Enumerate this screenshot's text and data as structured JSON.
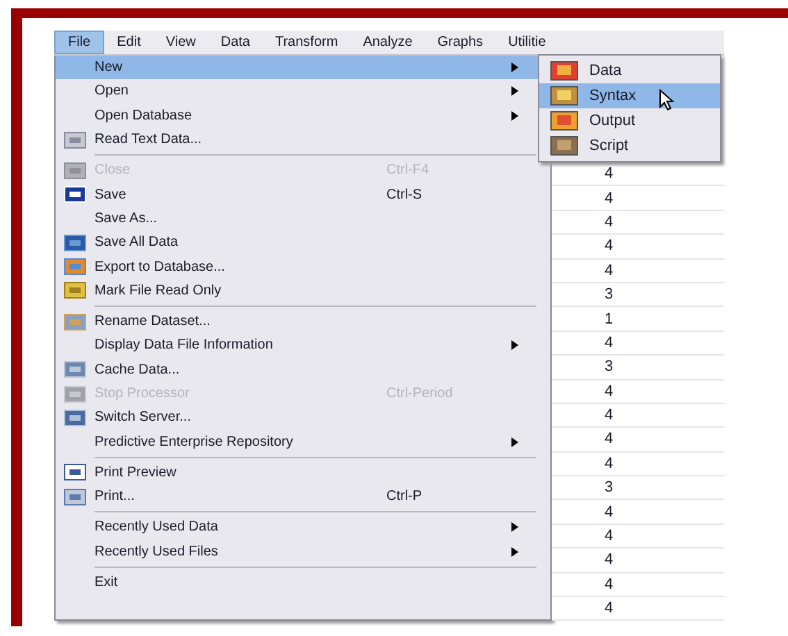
{
  "menubar": [
    {
      "label": "File",
      "selected": true
    },
    {
      "label": "Edit",
      "selected": false
    },
    {
      "label": "View",
      "selected": false
    },
    {
      "label": "Data",
      "selected": false
    },
    {
      "label": "Transform",
      "selected": false
    },
    {
      "label": "Analyze",
      "selected": false
    },
    {
      "label": "Graphs",
      "selected": false
    },
    {
      "label": "Utilitie",
      "selected": false
    }
  ],
  "file_menu": [
    [
      {
        "label": "New",
        "selected": true,
        "disabled": false,
        "has_submenu": true
      },
      {
        "label": "Open",
        "selected": false,
        "disabled": false,
        "has_submenu": true
      },
      {
        "label": "Open Database",
        "selected": false,
        "disabled": false,
        "has_submenu": true
      },
      {
        "label": "Read Text Data...",
        "selected": false,
        "disabled": false,
        "has_submenu": false
      }
    ],
    [
      {
        "label": "Close",
        "selected": false,
        "disabled": true,
        "has_submenu": false,
        "shortcut": "Ctrl-F4"
      },
      {
        "label": "Save",
        "selected": false,
        "disabled": false,
        "has_submenu": false,
        "shortcut": "Ctrl-S"
      },
      {
        "label": "Save As...",
        "selected": false,
        "disabled": false,
        "has_submenu": false
      },
      {
        "label": "Save All Data",
        "selected": false,
        "disabled": false,
        "has_submenu": false
      },
      {
        "label": "Export to Database...",
        "selected": false,
        "disabled": false,
        "has_submenu": false
      },
      {
        "label": "Mark File Read Only",
        "selected": false,
        "disabled": false,
        "has_submenu": false
      }
    ],
    [
      {
        "label": "Rename Dataset...",
        "selected": false,
        "disabled": false,
        "has_submenu": false
      },
      {
        "label": "Display Data File Information",
        "selected": false,
        "disabled": false,
        "has_submenu": true
      },
      {
        "label": "Cache Data...",
        "selected": false,
        "disabled": false,
        "has_submenu": false
      },
      {
        "label": "Stop Processor",
        "selected": false,
        "disabled": true,
        "has_submenu": false,
        "shortcut": "Ctrl-Period"
      },
      {
        "label": "Switch Server...",
        "selected": false,
        "disabled": false,
        "has_submenu": false
      },
      {
        "label": "Predictive Enterprise Repository",
        "selected": false,
        "disabled": false,
        "has_submenu": true
      }
    ],
    [
      {
        "label": "Print Preview",
        "selected": false,
        "disabled": false,
        "has_submenu": false
      },
      {
        "label": "Print...",
        "selected": false,
        "disabled": false,
        "has_submenu": false,
        "shortcut": "Ctrl-P"
      }
    ],
    [
      {
        "label": "Recently Used Data",
        "selected": false,
        "disabled": false,
        "has_submenu": true
      },
      {
        "label": "Recently Used Files",
        "selected": false,
        "disabled": false,
        "has_submenu": true
      }
    ],
    [
      {
        "label": "Exit",
        "selected": false,
        "disabled": false,
        "has_submenu": false
      }
    ]
  ],
  "new_submenu": [
    {
      "label": "Data",
      "selected": false
    },
    {
      "label": "Syntax",
      "selected": true
    },
    {
      "label": "Output",
      "selected": false
    },
    {
      "label": "Script",
      "selected": false
    }
  ],
  "grid_values": [
    "4",
    "4",
    "4",
    "4",
    "4",
    "3",
    "1",
    "4",
    "3",
    "4",
    "4",
    "4",
    "4",
    "3",
    "4",
    "4",
    "4",
    "4",
    "4"
  ]
}
